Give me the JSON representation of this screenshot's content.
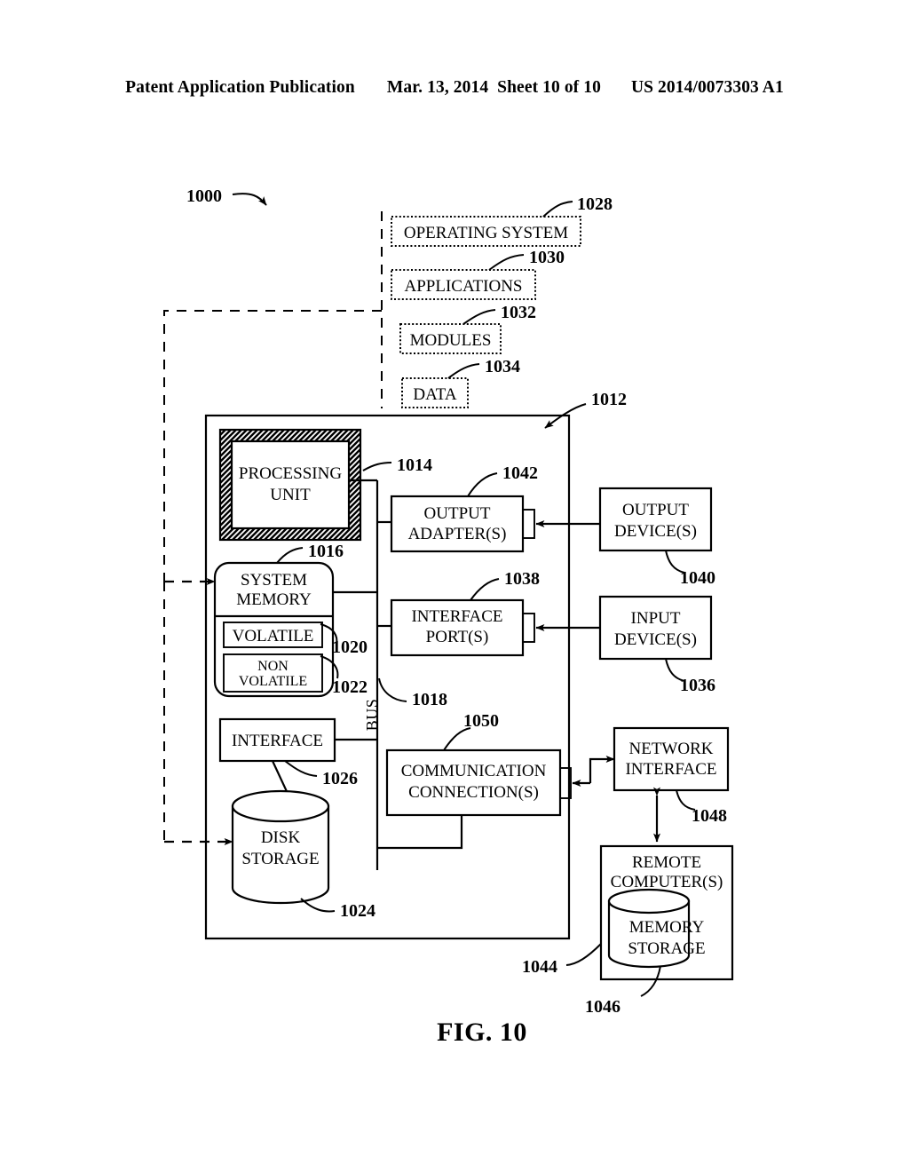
{
  "header": {
    "publication": "Patent Application Publication",
    "date": "Mar. 13, 2014",
    "sheet": "Sheet 10 of 10",
    "docnum": "US 2014/0073303 A1"
  },
  "figure": {
    "caption": "FIG. 10",
    "system_ref": "1000"
  },
  "software_stack": [
    {
      "label": "OPERATING SYSTEM",
      "ref": "1028"
    },
    {
      "label": "APPLICATIONS",
      "ref": "1030"
    },
    {
      "label": "MODULES",
      "ref": "1032"
    },
    {
      "label": "DATA",
      "ref": "1034"
    }
  ],
  "computer": {
    "ref": "1012",
    "bus_label": "BUS",
    "bus_ref": "1018"
  },
  "blocks": {
    "processing_unit": {
      "label": "PROCESSING UNIT",
      "ref": "1014"
    },
    "system_memory": {
      "label": "SYSTEM MEMORY",
      "ref": "1016"
    },
    "volatile": {
      "label": "VOLATILE",
      "ref": "1020"
    },
    "non_volatile": {
      "label": "NON VOLATILE",
      "ref": "1022"
    },
    "interface": {
      "label": "INTERFACE",
      "ref": "1026"
    },
    "disk_storage": {
      "label": "DISK STORAGE",
      "ref": "1024"
    },
    "output_adapters": {
      "label": "OUTPUT ADAPTER(S)",
      "ref": "1042"
    },
    "output_devices": {
      "label": "OUTPUT DEVICE(S)",
      "ref": "1040"
    },
    "interface_ports": {
      "label": "INTERFACE PORT(S)",
      "ref": "1038"
    },
    "input_devices": {
      "label": "INPUT DEVICE(S)",
      "ref": "1036"
    },
    "comm_connections": {
      "label": "COMMUNICATION CONNECTION(S)",
      "ref": "1050"
    },
    "network_interface": {
      "label": "NETWORK INTERFACE",
      "ref": "1048"
    },
    "remote_computers": {
      "label": "REMOTE COMPUTER(S)",
      "ref": "1044"
    },
    "memory_storage": {
      "label": "MEMORY STORAGE",
      "ref": "1046"
    }
  },
  "block_text": {
    "processing_unit_l1": "PROCESSING",
    "processing_unit_l2": "UNIT",
    "system_memory_l1": "SYSTEM",
    "system_memory_l2": "MEMORY",
    "non_volatile_l1": "NON",
    "non_volatile_l2": "VOLATILE",
    "disk_storage_l1": "DISK",
    "disk_storage_l2": "STORAGE",
    "output_adapters_l1": "OUTPUT",
    "output_adapters_l2": "ADAPTER(S)",
    "output_devices_l1": "OUTPUT",
    "output_devices_l2": "DEVICE(S)",
    "interface_ports_l1": "INTERFACE",
    "interface_ports_l2": "PORT(S)",
    "input_devices_l1": "INPUT",
    "input_devices_l2": "DEVICE(S)",
    "comm_connections_l1": "COMMUNICATION",
    "comm_connections_l2": "CONNECTION(S)",
    "network_interface_l1": "NETWORK",
    "network_interface_l2": "INTERFACE",
    "remote_computers_l1": "REMOTE",
    "remote_computers_l2": "COMPUTER(S)",
    "memory_storage_l1": "MEMORY",
    "memory_storage_l2": "STORAGE"
  },
  "colors": {
    "ink": "#000000",
    "paper": "#ffffff"
  }
}
